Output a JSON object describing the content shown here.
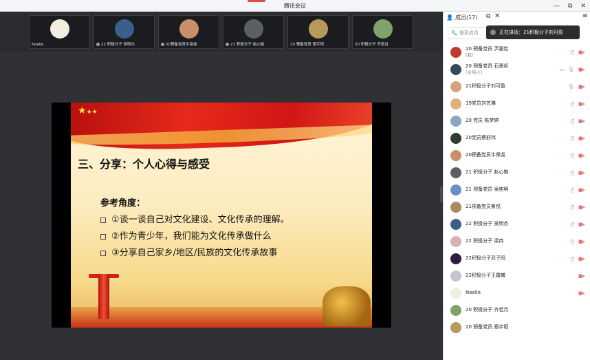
{
  "window": {
    "title": "腾讯会议",
    "controls": [
      "—",
      "⧉",
      "✕"
    ]
  },
  "participants_strip": [
    {
      "name": "Noelle",
      "color": "#f3efe0"
    },
    {
      "name": "22 积极分子 吴明杰",
      "color": "#3a5f8a"
    },
    {
      "name": "20预备党员牛保尧",
      "color": "#c98e6a"
    },
    {
      "name": "21 积极分子 赵心皓",
      "color": "#5d5f66"
    },
    {
      "name": "20 预备党员 裔宇阳",
      "color": "#b79a5a"
    },
    {
      "name": "20 积极分子 齐若月",
      "color": "#7fa36a"
    }
  ],
  "slide": {
    "heading": "三、分享：个人心得与感受",
    "subheading": "参考角度：",
    "items": [
      "①谈一谈自己对文化建设、文化传承的理解。",
      "②作为青少年，我们能为文化传承做什么",
      "③分享自己家乡/地区/民族的文化传承故事"
    ]
  },
  "panel": {
    "tab_label": "成员(17)",
    "search_placeholder": "搜索成员",
    "speaking_text": "正在讲话：21积极分子刘可盈",
    "members": [
      {
        "name": "20 预备党员 尹嘉怡",
        "role": "(我)",
        "color": "#c0392b",
        "mic": "off",
        "cam": "off"
      },
      {
        "name": "20 预备党员 石熹祯",
        "role": "(主持人)",
        "color": "#34495e",
        "mic": "on",
        "cam": "off",
        "share": true
      },
      {
        "name": "21积极分子刘可盈",
        "role": "",
        "color": "#d3a27f",
        "mic": "on",
        "cam": "off"
      },
      {
        "name": "19党员刘艺琳",
        "role": "",
        "color": "#e0b07a",
        "mic": "off",
        "cam": "off"
      },
      {
        "name": "20 党员 陈梦婷",
        "role": "",
        "color": "#8aa6c1",
        "mic": "off",
        "cam": "off"
      },
      {
        "name": "20党员蔡舒玮",
        "role": "",
        "color": "#2f3d2f",
        "mic": "off",
        "cam": "off"
      },
      {
        "name": "20预备党员牛保尧",
        "role": "",
        "color": "#c98e6a",
        "mic": "off",
        "cam": "off"
      },
      {
        "name": "21 积极分子 赵心皓",
        "role": "",
        "color": "#5d5f66",
        "mic": "off",
        "cam": "off"
      },
      {
        "name": "21 预备党员 吴奕明",
        "role": "",
        "color": "#6a8fc7",
        "mic": "off",
        "cam": "off"
      },
      {
        "name": "21预备党员鲁悦",
        "role": "",
        "color": "#a88b5c",
        "mic": "off",
        "cam": "off"
      },
      {
        "name": "22 积极分子 吴明杰",
        "role": "",
        "color": "#3a5f8a",
        "mic": "off",
        "cam": "off"
      },
      {
        "name": "22 积极分子 梁冉",
        "role": "",
        "color": "#d8b0b8",
        "mic": "off",
        "cam": "off"
      },
      {
        "name": "22积极分子邓子阳",
        "role": "",
        "color": "#2d1d3f",
        "mic": "off",
        "cam": "off"
      },
      {
        "name": "22积极分子王露曦",
        "role": "",
        "color": "#c7c3cf",
        "mic": "none",
        "cam": "off"
      },
      {
        "name": "Noelle",
        "role": "",
        "color": "#f3efe0",
        "mic": "none",
        "cam": "off"
      },
      {
        "name": "20 积极分子 齐若月",
        "role": "",
        "color": "#7fa36a",
        "mic": "none",
        "cam": "none"
      },
      {
        "name": "20 预备党员 裔宇阳",
        "role": "",
        "color": "#b79a5a",
        "mic": "none",
        "cam": "none"
      }
    ]
  }
}
